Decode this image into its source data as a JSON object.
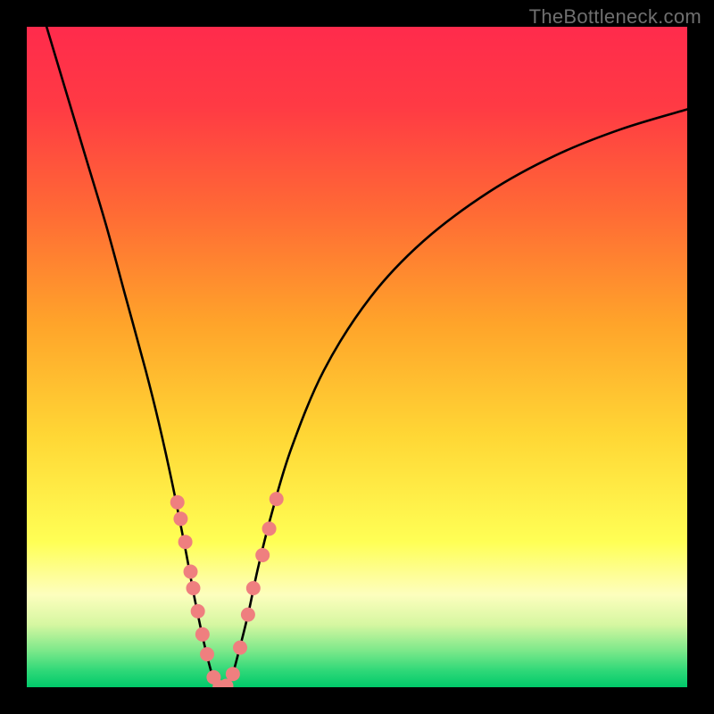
{
  "watermark": "TheBottleneck.com",
  "colors": {
    "frame": "#000000",
    "curve": "#000000",
    "dot_fill": "#ef7f7f",
    "dot_stroke": "#c85a5a",
    "gradient_stops": [
      {
        "offset": 0.0,
        "color": "#ff2b4c"
      },
      {
        "offset": 0.12,
        "color": "#ff3a44"
      },
      {
        "offset": 0.28,
        "color": "#ff6a35"
      },
      {
        "offset": 0.45,
        "color": "#ffa42a"
      },
      {
        "offset": 0.62,
        "color": "#ffd735"
      },
      {
        "offset": 0.78,
        "color": "#ffff55"
      },
      {
        "offset": 0.86,
        "color": "#fdfebe"
      },
      {
        "offset": 0.905,
        "color": "#d6f7a1"
      },
      {
        "offset": 0.945,
        "color": "#7be88a"
      },
      {
        "offset": 0.975,
        "color": "#2fd878"
      },
      {
        "offset": 1.0,
        "color": "#00c96a"
      }
    ]
  },
  "chart_data": {
    "type": "line",
    "title": "",
    "xlabel": "",
    "ylabel": "",
    "xlim": [
      0,
      100
    ],
    "ylim": [
      0,
      100
    ],
    "series": [
      {
        "name": "bottleneck-curve",
        "x": [
          3,
          6,
          9,
          12,
          15,
          18,
          20,
          22,
          24,
          25.5,
          27,
          28.2,
          29.2,
          30,
          31,
          32,
          33.5,
          35,
          37,
          40,
          45,
          52,
          60,
          70,
          80,
          90,
          100
        ],
        "values": [
          100,
          90,
          80,
          70,
          59,
          48,
          40,
          31,
          21,
          13,
          6,
          1.5,
          0,
          0,
          1.5,
          5,
          11,
          18,
          26,
          36,
          48,
          59,
          67.5,
          75,
          80.5,
          84.5,
          87.5
        ]
      }
    ],
    "annotations": {
      "scatter_dots": [
        {
          "x": 22.8,
          "y": 28.0
        },
        {
          "x": 23.3,
          "y": 25.5
        },
        {
          "x": 24.0,
          "y": 22.0
        },
        {
          "x": 24.8,
          "y": 17.5
        },
        {
          "x": 25.2,
          "y": 15.0
        },
        {
          "x": 25.9,
          "y": 11.5
        },
        {
          "x": 26.6,
          "y": 8.0
        },
        {
          "x": 27.3,
          "y": 5.0
        },
        {
          "x": 28.3,
          "y": 1.5
        },
        {
          "x": 29.2,
          "y": 0.0
        },
        {
          "x": 30.2,
          "y": 0.2
        },
        {
          "x": 31.2,
          "y": 2.0
        },
        {
          "x": 32.3,
          "y": 6.0
        },
        {
          "x": 33.5,
          "y": 11.0
        },
        {
          "x": 34.3,
          "y": 15.0
        },
        {
          "x": 35.7,
          "y": 20.0
        },
        {
          "x": 36.7,
          "y": 24.0
        },
        {
          "x": 37.8,
          "y": 28.5
        }
      ]
    }
  }
}
